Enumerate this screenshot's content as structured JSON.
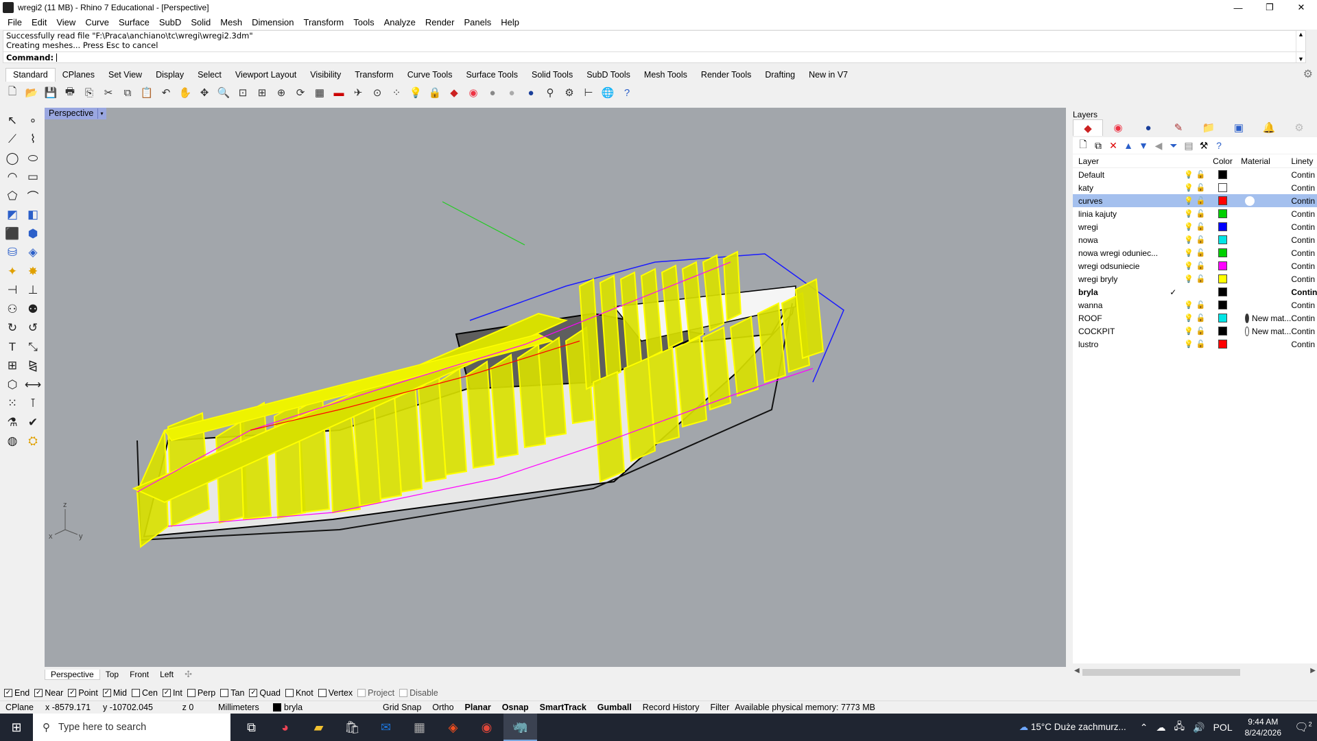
{
  "window": {
    "title": "wregi2 (11 MB) - Rhino 7 Educational - [Perspective]",
    "minimize": "—",
    "restore": "❐",
    "close": "✕"
  },
  "menu": [
    "File",
    "Edit",
    "View",
    "Curve",
    "Surface",
    "SubD",
    "Solid",
    "Mesh",
    "Dimension",
    "Transform",
    "Tools",
    "Analyze",
    "Render",
    "Panels",
    "Help"
  ],
  "command": {
    "history": [
      "Successfully read file \"F:\\Praca\\anchiano\\tc\\wregi\\wregi2.3dm\"",
      "Creating meshes... Press Esc to cancel"
    ],
    "prompt": "Command:"
  },
  "toolbar_tabs": [
    "Standard",
    "CPlanes",
    "Set View",
    "Display",
    "Select",
    "Viewport Layout",
    "Visibility",
    "Transform",
    "Curve Tools",
    "Surface Tools",
    "Solid Tools",
    "SubD Tools",
    "Mesh Tools",
    "Render Tools",
    "Drafting",
    "New in V7"
  ],
  "viewport": {
    "label": "Perspective",
    "axis_z": "z",
    "axis_x": "x",
    "axis_y": "y",
    "colors": {
      "background": "#a2a6ab",
      "rib_fill": "#d8e000",
      "rib_edge": "#ffff00",
      "curve_magenta": "#ff00ff",
      "curve_red": "#ff0000",
      "curve_blue": "#1a1aff",
      "axis_green": "#22cc22",
      "hull_light": "#e8e8e8",
      "hull_dark": "#5e5e5e"
    }
  },
  "viewport_tabs": [
    "Perspective",
    "Top",
    "Front",
    "Left"
  ],
  "osnaps": [
    {
      "label": "End",
      "checked": true
    },
    {
      "label": "Near",
      "checked": true
    },
    {
      "label": "Point",
      "checked": true
    },
    {
      "label": "Mid",
      "checked": true
    },
    {
      "label": "Cen",
      "checked": false
    },
    {
      "label": "Int",
      "checked": true
    },
    {
      "label": "Perp",
      "checked": false
    },
    {
      "label": "Tan",
      "checked": false
    },
    {
      "label": "Quad",
      "checked": true
    },
    {
      "label": "Knot",
      "checked": false
    },
    {
      "label": "Vertex",
      "checked": false
    },
    {
      "label": "Project",
      "checked": false,
      "disabled": true
    },
    {
      "label": "Disable",
      "checked": false,
      "disabled": true
    }
  ],
  "status": {
    "cplane": "CPlane",
    "x": "x -8579.171",
    "y": "y -10702.045",
    "z": "z 0",
    "units": "Millimeters",
    "layer": "bryla",
    "grid_snap": "Grid Snap",
    "ortho": "Ortho",
    "planar": "Planar",
    "osnap": "Osnap",
    "smarttrack": "SmartTrack",
    "gumball": "Gumball",
    "record_history": "Record History",
    "filter": "Filter",
    "memory": "Available physical memory: 7773 MB"
  },
  "layers_panel": {
    "title": "Layers",
    "columns": {
      "layer": "Layer",
      "color": "Color",
      "material": "Material",
      "linetype": "Linety"
    },
    "rows": [
      {
        "name": "Default",
        "color": "#000000",
        "material": "",
        "linetype": "Contin"
      },
      {
        "name": "katy",
        "color": "#ffffff",
        "material": "",
        "linetype": "Contin"
      },
      {
        "name": "curves",
        "color": "#ff0000",
        "material": "",
        "linetype": "Contin",
        "selected": true
      },
      {
        "name": "linia kajuty",
        "color": "#00d000",
        "material": "",
        "linetype": "Contin"
      },
      {
        "name": "wregi",
        "color": "#0000ff",
        "material": "",
        "linetype": "Contin"
      },
      {
        "name": "nowa",
        "color": "#00e5e5",
        "material": "",
        "linetype": "Contin"
      },
      {
        "name": "nowa wregi oduniec...",
        "color": "#00d000",
        "material": "",
        "linetype": "Contin"
      },
      {
        "name": "wregi odsuniecie",
        "color": "#ff00ff",
        "material": "",
        "linetype": "Contin"
      },
      {
        "name": "wregi bryly",
        "color": "#ffff00",
        "material": "",
        "linetype": "Contin"
      },
      {
        "name": "bryla",
        "color": "#000000",
        "material": "",
        "linetype": "Contin",
        "current": true
      },
      {
        "name": "wanna",
        "color": "#000000",
        "material": "",
        "linetype": "Contin"
      },
      {
        "name": "ROOF",
        "color": "#00e5e5",
        "material": "New mat...",
        "material_ball": "#333333",
        "linetype": "Contin"
      },
      {
        "name": "COCKPIT",
        "color": "#000000",
        "material": "New mat...",
        "material_ball": "#ffffff",
        "linetype": "Contin"
      },
      {
        "name": "lustro",
        "color": "#ff0000",
        "material": "",
        "linetype": "Contin"
      }
    ],
    "current_mark": "✓"
  },
  "taskbar": {
    "search_placeholder": "Type here to search",
    "weather": "15°C  Duże zachmurz...",
    "language": "POL",
    "time": "9:44 AM",
    "date": "8/24/2026",
    "notif_count": "2"
  }
}
